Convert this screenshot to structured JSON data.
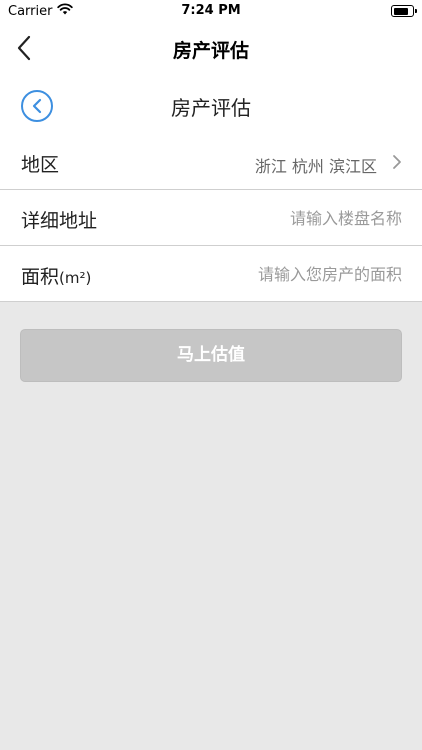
{
  "status_bar": {
    "carrier": "Carrier",
    "time": "7:24 PM"
  },
  "nav": {
    "title": "房产评估"
  },
  "page": {
    "title": "房产评估"
  },
  "form": {
    "region": {
      "label": "地区",
      "value": "浙江 杭州 滨江区"
    },
    "address": {
      "label": "详细地址",
      "placeholder": "请输入楼盘名称"
    },
    "area": {
      "label": "面积",
      "unit": "(m²)",
      "placeholder": "请输入您房产的面积"
    }
  },
  "submit": {
    "label": "马上估值"
  },
  "colors": {
    "accent": "#3d8fe0",
    "button_disabled": "#c6c6c6",
    "background": "#e8e8e8"
  },
  "icons": {
    "back": "chevron-left-icon",
    "circle_back": "circle-back-icon",
    "chevron": "chevron-right-icon",
    "wifi": "wifi-icon",
    "battery": "battery-icon"
  }
}
